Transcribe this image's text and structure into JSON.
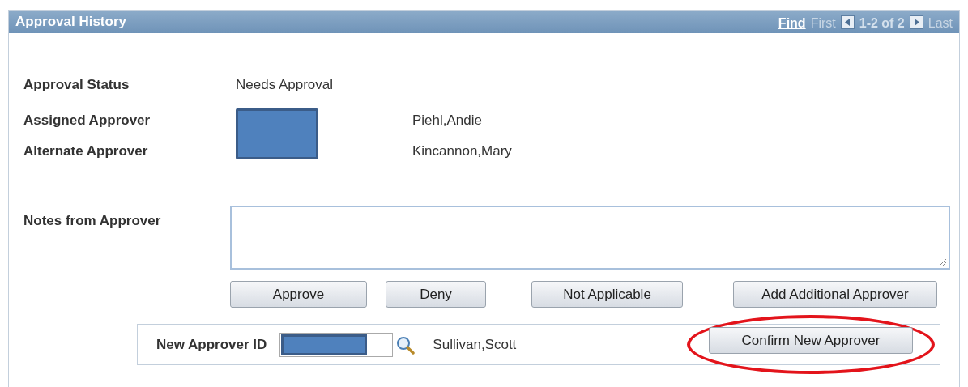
{
  "panel": {
    "title": "Approval History",
    "nav": [
      {
        "kind": "link",
        "label": "Find",
        "disabled": false
      },
      {
        "kind": "link",
        "label": "First",
        "disabled": true
      },
      {
        "kind": "prev",
        "disabled": false
      },
      {
        "kind": "text",
        "label": "1-2 of 2"
      },
      {
        "kind": "next",
        "disabled": false
      },
      {
        "kind": "link",
        "label": "Last",
        "disabled": true
      }
    ]
  },
  "approval_status": {
    "label": "Approval Status",
    "value": "Needs Approval"
  },
  "approvers": [
    {
      "label": "Assigned Approver",
      "name": "Piehl,Andie"
    },
    {
      "label": "Alternate Approver",
      "name": "Kincannon,Mary"
    }
  ],
  "notes": {
    "label": "Notes from Approver"
  },
  "buttons": [
    "Approve",
    "Deny",
    "Not Applicable",
    "Add Additional Approver"
  ],
  "new_approver": {
    "label": "New Approver ID",
    "name": "Sullivan,Scott",
    "button": "Confirm New Approver",
    "highlighted": true
  }
}
